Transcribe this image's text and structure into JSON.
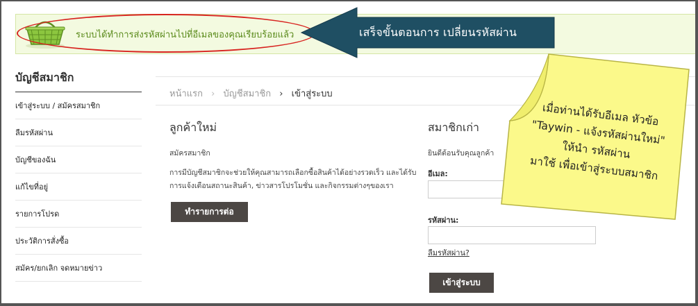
{
  "notice": {
    "message": "ระบบได้ทำการส่งรหัสผ่านไปที่อีเมลของคุณเรียบร้อยแล้ว",
    "icon": "basket-icon",
    "highlight_color": "#d8231f"
  },
  "annotation_arrow": {
    "text": "เสร็จขั้นตอนการ เปลี่ยนรหัสผ่าน",
    "color": "#1f4f63"
  },
  "sidebar": {
    "title": "บัญชีสมาชิก",
    "items": [
      {
        "label": "เข้าสู่ระบบ / สมัครสมาชิก"
      },
      {
        "label": "ลืมรหัสผ่าน"
      },
      {
        "label": "บัญชีของฉัน"
      },
      {
        "label": "แก้ไขที่อยู่"
      },
      {
        "label": "รายการโปรด"
      },
      {
        "label": "ประวัติการสั่งซื้อ"
      },
      {
        "label": "สมัคร/ยกเลิก จดหมายข่าว"
      }
    ]
  },
  "breadcrumb": {
    "home": "หน้าแรก",
    "account": "บัญชีสมาชิก",
    "current": "เข้าสู่ระบบ"
  },
  "new_customer": {
    "title": "ลูกค้าใหม่",
    "subtitle": "สมัครสมาชิก",
    "description": "การมีบัญชีสมาชิกจะช่วยให้คุณสามารถเลือกซื้อสินค้าได้อย่างรวดเร็ว และได้รับการแจ้งเตือนสถานะสินค้า, ข่าวสารโปรโมชั่น และกิจกรรมต่างๆของเรา",
    "button": "ทำรายการต่อ"
  },
  "existing_member": {
    "title": "สมาชิกเก่า",
    "subtitle": "ยินดีต้อนรับคุณลูกค้า",
    "email_label": "อีเมล:",
    "email_value": "",
    "password_label": "รหัสผ่าน:",
    "password_value": "",
    "forgot_link": "ลืมรหัสผ่าน?",
    "button": "เข้าสู่ระบบ"
  },
  "sticky_note": {
    "lines": [
      "เมื่อท่านได้รับอีเมล หัวข้อ",
      "\"Taywin - แจ้งรหัสผ่านใหม่\"",
      "ให้นำ รหัสผ่าน",
      "มาใช้ เพื่อเข้าสู่ระบบสมาชิก"
    ],
    "color": "#fbf98a"
  }
}
